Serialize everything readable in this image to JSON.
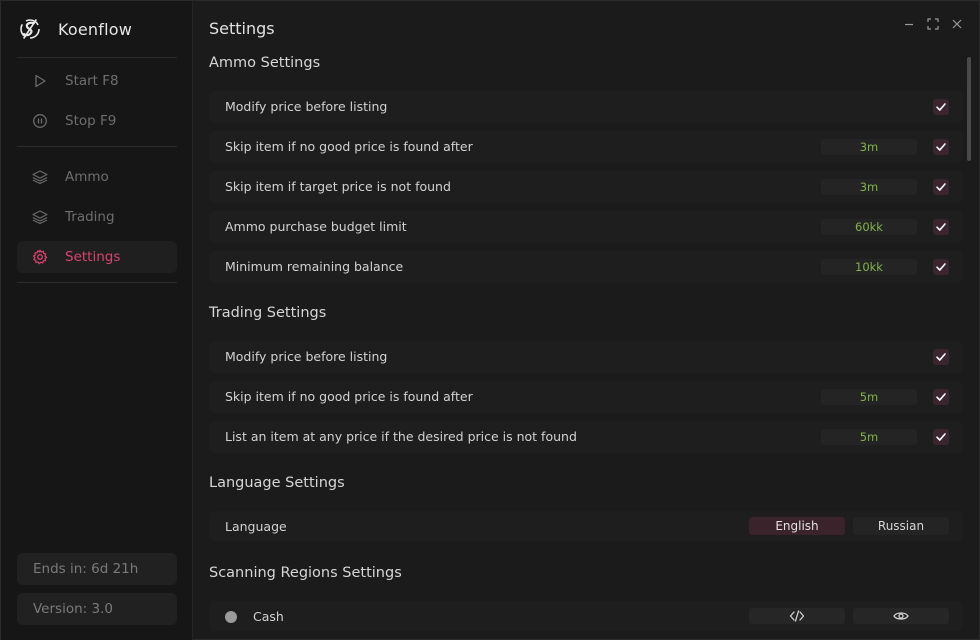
{
  "app": {
    "name": "Koenflow",
    "logo_icon": "koenflow-logo-icon",
    "accent_color": "#d9446f"
  },
  "sidebar": {
    "controls": [
      {
        "label": "Start F8",
        "icon": "play-icon"
      },
      {
        "label": "Stop F9",
        "icon": "pause-circle-icon"
      }
    ],
    "nav": [
      {
        "label": "Ammo",
        "icon": "layers-icon",
        "active": false
      },
      {
        "label": "Trading",
        "icon": "layers-icon",
        "active": false
      },
      {
        "label": "Settings",
        "icon": "gear-icon",
        "active": true
      }
    ],
    "license_text": "Ends in: 6d 21h",
    "version_text": "Version: 3.0"
  },
  "window_controls": [
    "minimize-icon",
    "maximize-icon",
    "close-icon"
  ],
  "page": {
    "title": "Settings"
  },
  "ammo_settings": {
    "title": "Ammo Settings",
    "rows": [
      {
        "label": "Modify price before listing",
        "value": null,
        "checked": true
      },
      {
        "label": "Skip item if no good price is found after",
        "value": "3m",
        "checked": true
      },
      {
        "label": "Skip item if target price is not found",
        "value": "3m",
        "checked": true
      },
      {
        "label": "Ammo purchase budget limit",
        "value": "60kk",
        "checked": true
      },
      {
        "label": "Minimum remaining balance",
        "value": "10kk",
        "checked": true
      }
    ]
  },
  "trading_settings": {
    "title": "Trading Settings",
    "rows": [
      {
        "label": "Modify price before listing",
        "value": null,
        "checked": true
      },
      {
        "label": "Skip item if no good price is found after",
        "value": "5m",
        "checked": true
      },
      {
        "label": "List an item at any price if the desired price is not found",
        "value": "5m",
        "checked": true
      }
    ]
  },
  "language_settings": {
    "title": "Language Settings",
    "label": "Language",
    "options": [
      "English",
      "Russian"
    ],
    "selected": "English"
  },
  "scanning_regions": {
    "title": "Scanning Regions Settings",
    "rows": [
      {
        "label": "Cash",
        "status_color": "#9a9a9a",
        "actions": [
          "code-icon",
          "eye-icon"
        ]
      }
    ]
  }
}
